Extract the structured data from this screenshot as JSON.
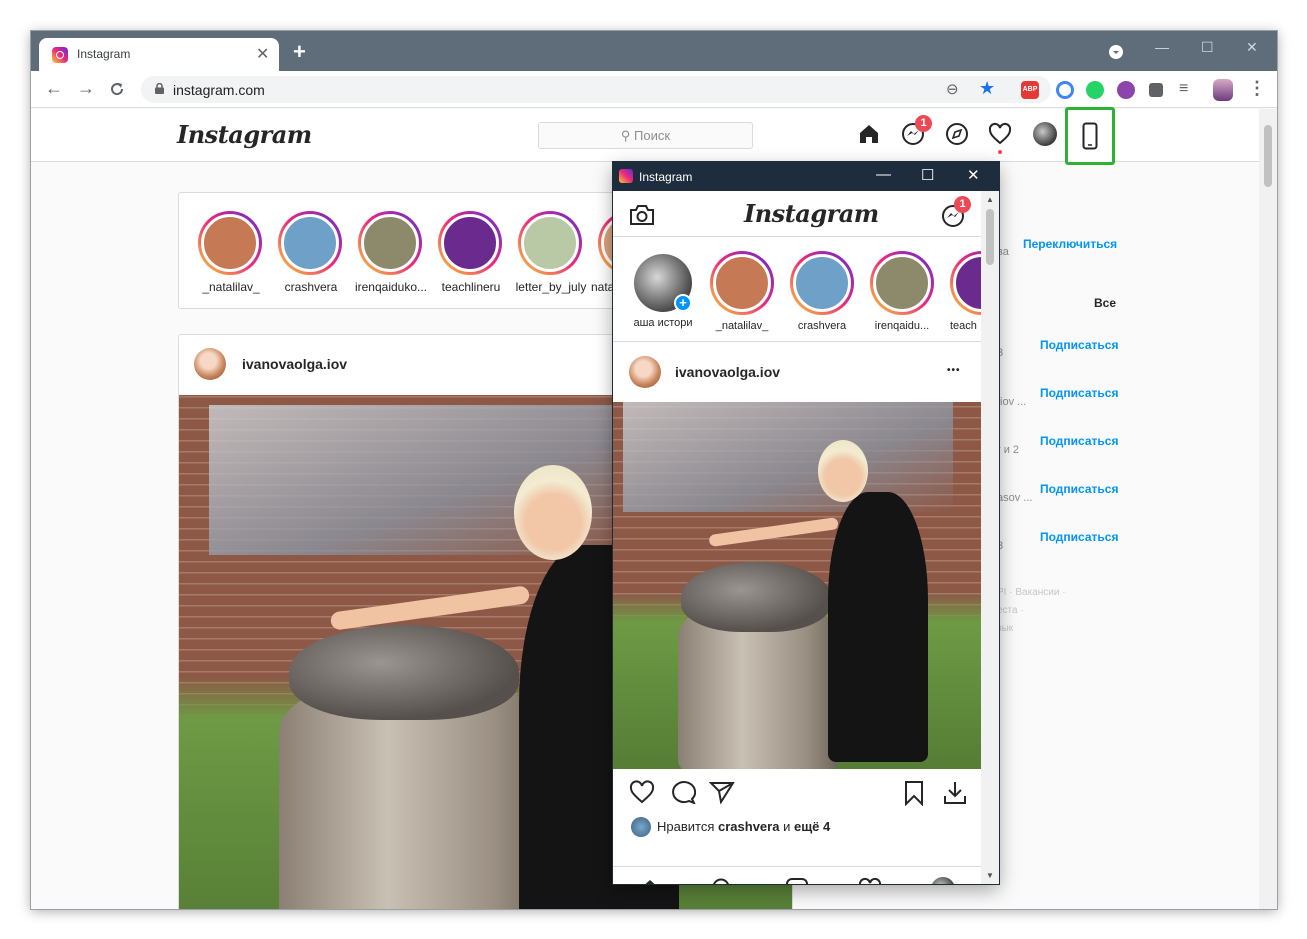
{
  "browser": {
    "tab_title": "Instagram",
    "tab_close": "✕",
    "new_tab": "+",
    "url": "instagram.com",
    "controls": {
      "minimize": "—",
      "maximize": "☐",
      "close": "✕"
    }
  },
  "instagram": {
    "logo": "Instagram",
    "search_placeholder": "Поиск",
    "messages_badge": "1",
    "stories": [
      {
        "username": "_natalilav_",
        "color": "#c57a55"
      },
      {
        "username": "crashvera",
        "color": "#6fa0c8"
      },
      {
        "username": "irenqaiduko...",
        "color": "#8d8a6c"
      },
      {
        "username": "teachlineru",
        "color": "#6a2a8e"
      },
      {
        "username": "letter_by_july",
        "color": "#b9c9a5"
      },
      {
        "username": "nata",
        "color": "#d9a37c"
      }
    ],
    "post": {
      "username": "ivanovaolga.iov"
    },
    "sidebar": {
      "switch_label": "Переключиться",
      "all_label": "Все",
      "follow_labels": [
        "Подписаться",
        "Подписаться",
        "Подписаться",
        "Подписаться",
        "Подписаться"
      ],
      "partial_texts": [
        "ва",
        "3",
        ".iov ...",
        "r и 2",
        "asov ...",
        "3"
      ],
      "footer_lines": [
        "PI · Вакансии ·",
        "еста ·",
        "зык"
      ]
    }
  },
  "popup": {
    "title": "Instagram",
    "controls": {
      "minimize": "—",
      "maximize": "☐",
      "close": "✕"
    },
    "logo": "Instagram",
    "messages_badge": "1",
    "stories": [
      {
        "username": "аша истори",
        "color": "#6b6b6b"
      },
      {
        "username": "_natalilav_",
        "color": "#c57a55"
      },
      {
        "username": "crashvera",
        "color": "#6fa0c8"
      },
      {
        "username": "irenqaidu...",
        "color": "#8d8a6c"
      },
      {
        "username": "teach",
        "color": "#6a2a8e"
      }
    ],
    "post": {
      "username": "ivanovaolga.iov",
      "more": "•••",
      "likes_prefix": "Нравится",
      "likes_user": "crashvera",
      "likes_and": "и",
      "likes_suffix": "ещё 4"
    }
  }
}
